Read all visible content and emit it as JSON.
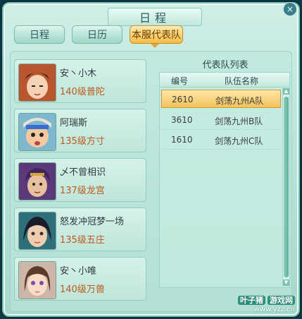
{
  "window": {
    "title": "日程",
    "close_label": "×"
  },
  "tabs": [
    {
      "label": "日程"
    },
    {
      "label": "日历"
    },
    {
      "label": "本服代表队"
    }
  ],
  "members": [
    {
      "name": "安丶小木",
      "level": "140级普陀"
    },
    {
      "name": "阿瑞斯",
      "level": "135级方寸"
    },
    {
      "name": "乄不曾相识",
      "level": "137级龙宫"
    },
    {
      "name": "怒发冲冠梦一场",
      "level": "135级五庄"
    },
    {
      "name": "安丶小唯",
      "level": "140级万兽"
    }
  ],
  "team_list": {
    "title": "代表队列表",
    "headers": [
      "编号",
      "队伍名称"
    ],
    "rows": [
      {
        "id": "2610",
        "name": "剑荡九州A队"
      },
      {
        "id": "3610",
        "name": "剑荡九州B队"
      },
      {
        "id": "1610",
        "name": "剑荡九州C队"
      }
    ]
  },
  "watermark": {
    "brand": "叶子猪",
    "tag": "游戏网",
    "url": "www.yzz.cn"
  },
  "colors": {
    "active_tab": "#f4be47",
    "level_text": "#bb5a1a"
  }
}
